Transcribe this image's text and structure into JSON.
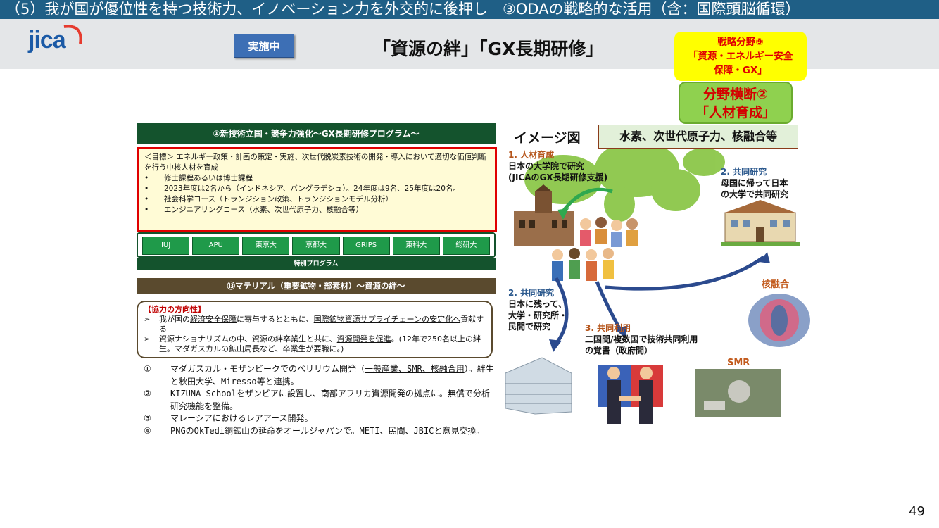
{
  "topbar": {
    "text": "（5）我が国が優位性を持つ技術力、イノベーション力を外交的に後押し　③ODAの戦略的な活用（含：国際頭脳循環）"
  },
  "header": {
    "logo": "jica",
    "status_badge": "実施中",
    "title": "「資源の絆」「GX長期研修」",
    "strategy_lines": [
      "戦略分野⑨",
      "「資源・エネルギー安全",
      "保障・GX」"
    ],
    "cross_lines": [
      "分野横断②",
      "「人材育成」"
    ]
  },
  "gx_program": {
    "header": "①新技術立国・競争力強化〜GX長期研修プログラム〜",
    "goal": "＜目標＞ エネルギー政策・計画の策定・実施、次世代脱炭素技術の開発・導入において適切な価値判断を行う中核人材を育成",
    "bullets": [
      "修士課程あるいは博士課程",
      "2023年度は2名から（インドネシア、バングラデシュ）。24年度は9名、25年度は20名。",
      "社会科学コース（トランジション政策、トランジションモデル分析）",
      "エンジニアリングコース（水素、次世代原子力、核融合等）"
    ],
    "bullet_mark": "•",
    "universities": [
      "IUJ",
      "APU",
      "東京大",
      "京都大",
      "GRIPS",
      "東科大",
      "総研大"
    ],
    "special": "特別プログラム"
  },
  "materials": {
    "header": "⑬マテリアル（重要鉱物・部素材）〜資源の絆〜",
    "coop_title": "【協力の方向性】",
    "arrow": "➢",
    "item1": {
      "a": "我が国の",
      "b": "経済安全保障",
      "c": "に寄与するとともに、",
      "d": "国際鉱物資源サプライチェーンの安定化",
      "e": "へ",
      "f": "貢献する"
    },
    "item2": {
      "a": "資源ナショナリズムの中、資源の絆卒業生と共に、",
      "b": "資源開発を促進",
      "c": "。(12年で250名以上の絆生。マダガスカルの鉱山局長など、卒業生が要職に。)"
    },
    "list": [
      {
        "n": "①",
        "text_a": "マダガスカル・モザンビークでのベリリウム開発（",
        "text_u": "一般産業、SMR、核融合用",
        "text_b": "）。絆生と秋田大学、Miresso等と連携。"
      },
      {
        "n": "②",
        "text": "KIZUNA Schoolをザンビアに設置し、南部アフリカ資源開発の拠点に。無償で分析研究機能を整備。"
      },
      {
        "n": "③",
        "text": "マレーシアにおけるレアアース開発。"
      },
      {
        "n": "④",
        "text": "PNGのOkTedi銅鉱山の延命をオールジャパンで。METI、民間、JBICと意見交換。"
      }
    ]
  },
  "image": {
    "title": "イメージ図",
    "badge": "水素、次世代原子力、核融合等",
    "l1_head": "1. 人材育成",
    "l1_lines": [
      "日本の大学院で研究",
      "(JICAのGX長期研修支援)"
    ],
    "l2r_head": "2. 共同研究",
    "l2r_lines": [
      "母国に帰って日本",
      "の大学で共同研究"
    ],
    "l2l_head": "2. 共同研究",
    "l2l_lines": [
      "日本に残って、",
      "大学・研究所・",
      "民間で研究"
    ],
    "l3_head": "3. 共同利用",
    "l3_lines": [
      "二国間/複数国で技術共同利用",
      "の覚書（政府間）"
    ],
    "fusion": "核融合",
    "smr": "SMR"
  },
  "colors": {
    "topbar": "#1f5f86",
    "accent_green": "#14532d",
    "alert_red": "#e00000",
    "yellow": "#ffff00"
  },
  "page_number": "49"
}
